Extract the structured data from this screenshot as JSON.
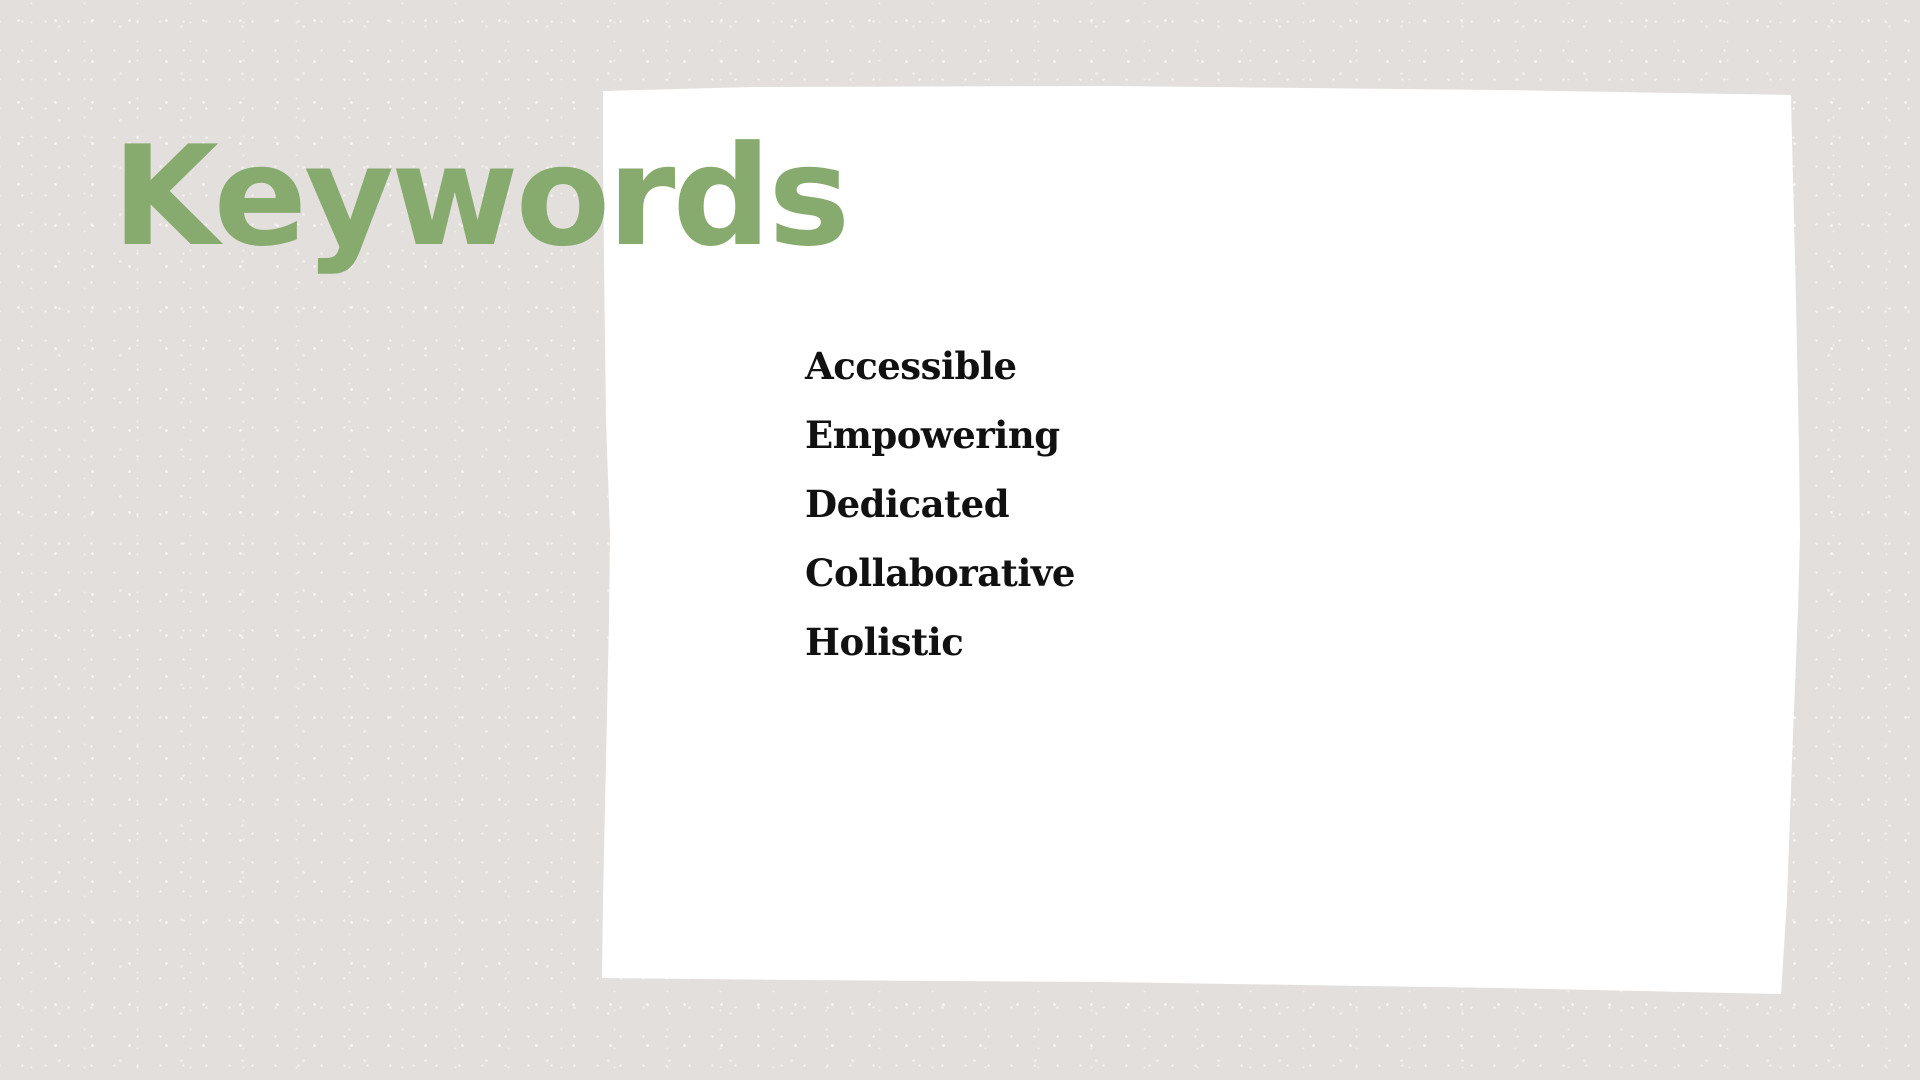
{
  "slide": {
    "title": "Keywords",
    "keywords": [
      "Accessible",
      "Empowering",
      "Dedicated",
      "Collaborative",
      "Holistic"
    ]
  },
  "colors": {
    "background": "#e3dfdc",
    "paper": "#ffffff",
    "title": "#87aa6e",
    "text": "#111111"
  }
}
